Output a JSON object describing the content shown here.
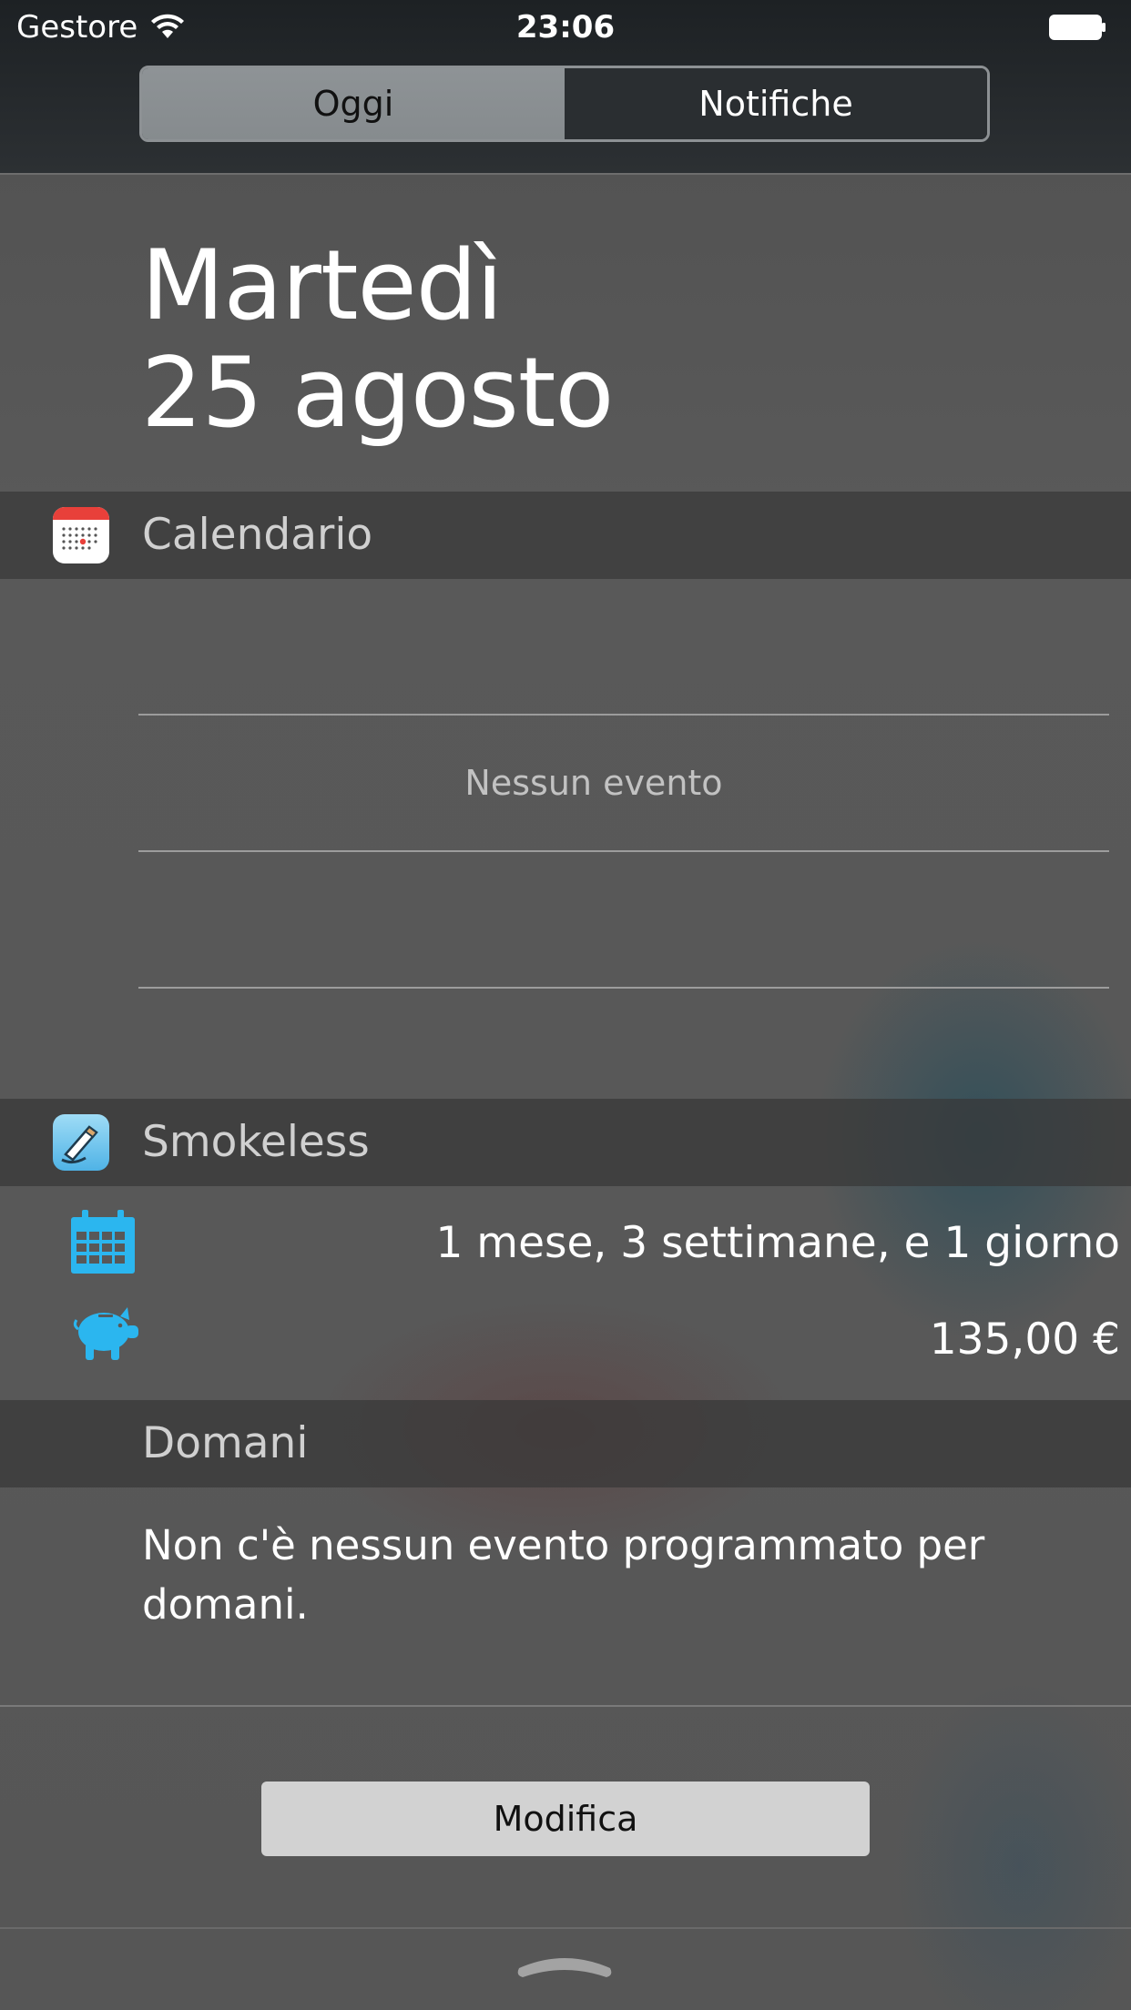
{
  "status_bar": {
    "carrier": "Gestore",
    "time": "23:06",
    "wifi_icon": "wifi-icon",
    "battery_icon": "battery-full-icon"
  },
  "segmented_control": {
    "tabs": [
      {
        "label": "Oggi",
        "selected": true
      },
      {
        "label": "Notifiche",
        "selected": false
      }
    ]
  },
  "date": {
    "weekday": "Martedì",
    "day_month": "25 agosto"
  },
  "calendar_widget": {
    "title": "Calendario",
    "icon": "calendar-app-icon",
    "empty_text": "Nessun evento"
  },
  "smokeless_widget": {
    "title": "Smokeless",
    "icon": "smokeless-app-icon",
    "rows": [
      {
        "icon": "calendar-grid-icon",
        "value": "1 mese, 3 settimane, e 1 giorno"
      },
      {
        "icon": "piggy-bank-icon",
        "value": "135,00 €"
      }
    ]
  },
  "tomorrow": {
    "title": "Domani",
    "text": "Non c'è nessun evento programmato per domani."
  },
  "edit_button": {
    "label": "Modifica"
  },
  "handle_icon": "pull-up-handle-icon",
  "colors": {
    "accent_blue": "#2bb6ef",
    "background": "#585858",
    "header_bar": "#262a2d"
  }
}
